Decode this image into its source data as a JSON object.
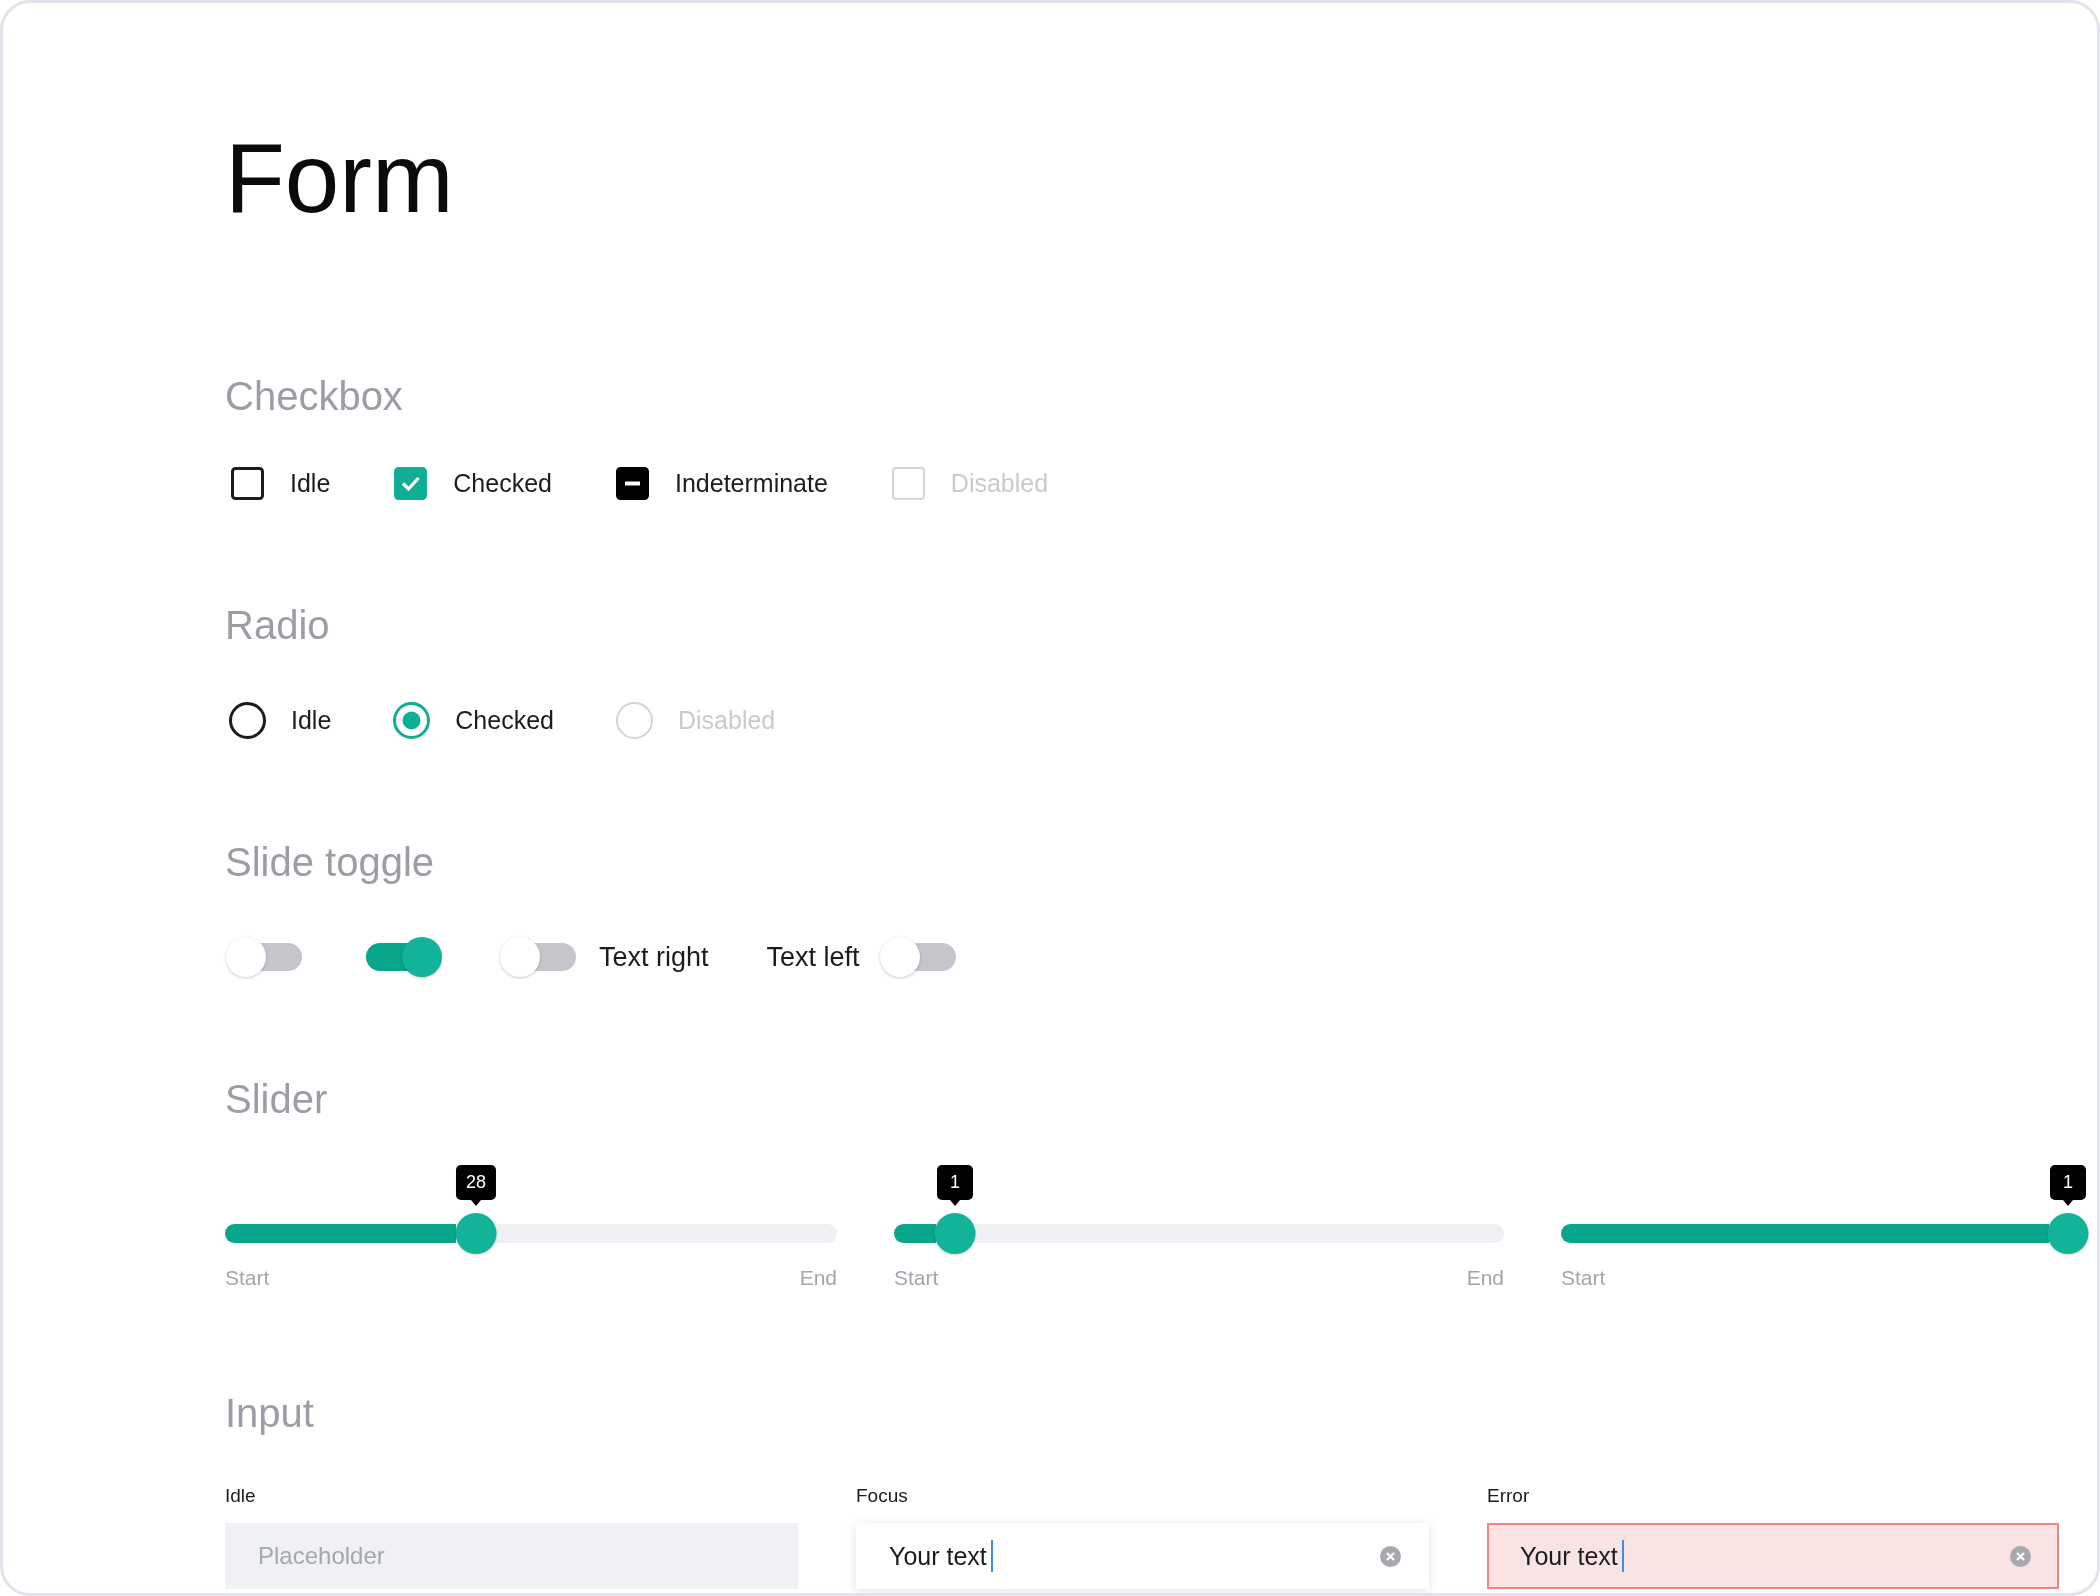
{
  "title": "Form",
  "checkbox_section": {
    "heading": "Checkbox",
    "items": [
      {
        "label": "Idle",
        "checked": false,
        "indeterminate": false,
        "disabled": false
      },
      {
        "label": "Checked",
        "checked": true,
        "indeterminate": false,
        "disabled": false
      },
      {
        "label": "Indeterminate",
        "checked": false,
        "indeterminate": true,
        "disabled": false
      },
      {
        "label": "Disabled",
        "checked": false,
        "indeterminate": false,
        "disabled": true
      }
    ]
  },
  "radio_section": {
    "heading": "Radio",
    "items": [
      {
        "label": "Idle",
        "selected": false,
        "disabled": false
      },
      {
        "label": "Checked",
        "selected": true,
        "disabled": false
      },
      {
        "label": "Disabled",
        "selected": false,
        "disabled": true
      }
    ]
  },
  "toggle_section": {
    "heading": "Slide toggle",
    "items": [
      {
        "kind": "plain",
        "on": false
      },
      {
        "kind": "plain",
        "on": true
      },
      {
        "kind": "label-right",
        "on": false,
        "label": "Text right"
      },
      {
        "kind": "label-left",
        "on": false,
        "label": "Text left"
      }
    ]
  },
  "slider_section": {
    "heading": "Slider",
    "items": [
      {
        "value": "28",
        "level": 0.41,
        "start_label": "Start",
        "end_label": "End"
      },
      {
        "value": "1",
        "level": 0.1,
        "start_label": "Start",
        "end_label": "End"
      },
      {
        "value": "1",
        "level": 1,
        "start_label": "Start"
      }
    ]
  },
  "input_section": {
    "heading": "Input",
    "items": [
      {
        "label": "Idle",
        "placeholder": "Placeholder",
        "focused": false,
        "error": false
      },
      {
        "label": "Focus",
        "value": "Your text",
        "focused": true,
        "error": false
      },
      {
        "label": "Error",
        "value": "Your text",
        "focused": true,
        "error": true
      }
    ]
  }
}
